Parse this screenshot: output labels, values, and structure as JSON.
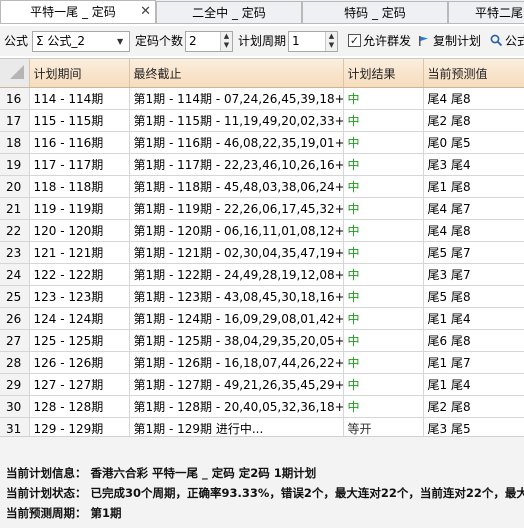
{
  "tabs": [
    {
      "label": "平特一尾 _ 定码",
      "active": true,
      "closable": true
    },
    {
      "label": "二全中 _ 定码",
      "active": false
    },
    {
      "label": "特码 _ 定码",
      "active": false
    },
    {
      "label": "平特二尾",
      "active": false
    }
  ],
  "toolbar": {
    "formula_label": "公式",
    "formula_value": "Σ 公式_2",
    "count_label": "定码个数",
    "count_value": "2",
    "period_label": "计划周期",
    "period_value": "1",
    "allow_group_label": "允许群发",
    "allow_group_checked": true,
    "copy_plan_label": "复制计划",
    "formula_search_label": "公式"
  },
  "table": {
    "columns": [
      "计划期间",
      "最终截止",
      "计划结果",
      "当前预测值"
    ],
    "rows": [
      {
        "n": "16",
        "period": "114 - 114期",
        "detail": "第1期 - 114期 - 07,24,26,45,39,18+44",
        "result": "中",
        "pred": "尾4 尾8"
      },
      {
        "n": "17",
        "period": "115 - 115期",
        "detail": "第1期 - 115期 - 11,19,49,20,02,33+06",
        "result": "中",
        "pred": "尾2 尾8"
      },
      {
        "n": "18",
        "period": "116 - 116期",
        "detail": "第1期 - 116期 - 46,08,22,35,19,01+30",
        "result": "中",
        "pred": "尾0 尾5"
      },
      {
        "n": "19",
        "period": "117 - 117期",
        "detail": "第1期 - 117期 - 22,23,46,10,26,16+25",
        "result": "中",
        "pred": "尾3 尾4"
      },
      {
        "n": "20",
        "period": "118 - 118期",
        "detail": "第1期 - 118期 - 45,48,03,38,06,24+05",
        "result": "中",
        "pred": "尾1 尾8"
      },
      {
        "n": "21",
        "period": "119 - 119期",
        "detail": "第1期 - 119期 - 22,26,06,17,45,32+24",
        "result": "中",
        "pred": "尾4 尾7"
      },
      {
        "n": "22",
        "period": "120 - 120期",
        "detail": "第1期 - 120期 - 06,16,11,01,08,12+41",
        "result": "中",
        "pred": "尾4 尾8"
      },
      {
        "n": "23",
        "period": "121 - 121期",
        "detail": "第1期 - 121期 - 02,30,04,35,47,19+25",
        "result": "中",
        "pred": "尾5 尾7"
      },
      {
        "n": "24",
        "period": "122 - 122期",
        "detail": "第1期 - 122期 - 24,49,28,19,12,08+37",
        "result": "中",
        "pred": "尾3 尾7"
      },
      {
        "n": "25",
        "period": "123 - 123期",
        "detail": "第1期 - 123期 - 43,08,45,30,18,16+27",
        "result": "中",
        "pred": "尾5 尾8"
      },
      {
        "n": "26",
        "period": "124 - 124期",
        "detail": "第1期 - 124期 - 16,09,29,08,01,42+49",
        "result": "中",
        "pred": "尾1 尾4"
      },
      {
        "n": "27",
        "period": "125 - 125期",
        "detail": "第1期 - 125期 - 38,04,29,35,20,05+36",
        "result": "中",
        "pred": "尾6 尾8"
      },
      {
        "n": "28",
        "period": "126 - 126期",
        "detail": "第1期 - 126期 - 16,18,07,44,26,22+09",
        "result": "中",
        "pred": "尾1 尾7"
      },
      {
        "n": "29",
        "period": "127 - 127期",
        "detail": "第1期 - 127期 - 49,21,26,35,45,29+41",
        "result": "中",
        "pred": "尾1 尾4"
      },
      {
        "n": "30",
        "period": "128 - 128期",
        "detail": "第1期 - 128期 - 20,40,05,32,36,18+07",
        "result": "中",
        "pred": "尾2 尾8"
      },
      {
        "n": "31",
        "period": "129 - 129期",
        "detail": "第1期 - 129期 进行中...",
        "result": "等开",
        "pred": "尾3 尾5"
      }
    ]
  },
  "status": {
    "info": "当前计划信息： 香港六合彩    平特一尾 _ 定码    定2码    1期计划",
    "state": "当前计划状态： 已完成30个周期，正确率93.33%，错误2个，最大连对22个，当前连对22个，最大",
    "period": "当前预测周期： 第1期"
  },
  "colors": {
    "hit": "#1aa11a",
    "header_top": "#fbeede",
    "header_bottom": "#f6dcbc",
    "flag_icon": "#2a7fd4"
  }
}
